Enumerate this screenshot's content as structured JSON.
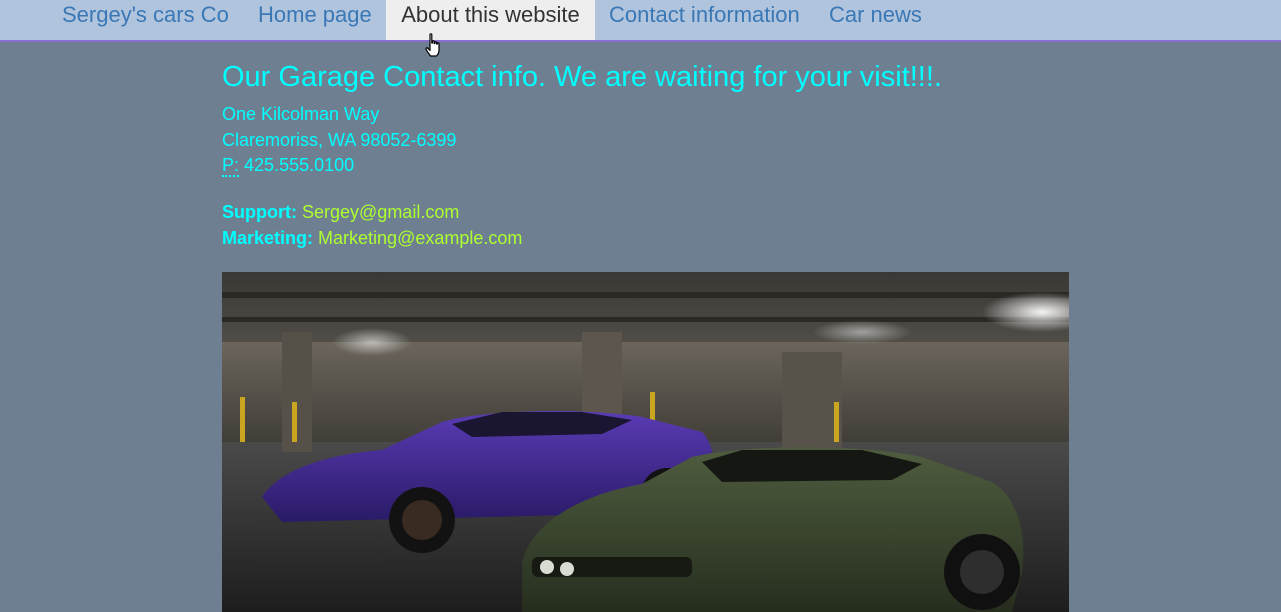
{
  "nav": {
    "brand": "Sergey's cars Co",
    "items": [
      {
        "label": "Home page"
      },
      {
        "label": "About this website"
      },
      {
        "label": "Contact information"
      },
      {
        "label": "Car news"
      }
    ],
    "active_index": 1
  },
  "main": {
    "title": "Our Garage Contact info. We are waiting for your visit!!!.",
    "address": {
      "street": "One Kilcolman Way",
      "city_line": "Claremoriss, WA 98052-6399",
      "phone_abbr": "P:",
      "phone": "425.555.0100"
    },
    "contacts": [
      {
        "label": "Support:",
        "email": "Sergey@gmail.com"
      },
      {
        "label": "Marketing:",
        "email": "Marketing@example.com"
      }
    ]
  },
  "photo": {
    "subject": "two muscle cars (purple and dark green) in a parking garage"
  },
  "colors": {
    "page_background": "#6e7f91",
    "navbar_background": "#b0c4de",
    "nav_link": "#3a78b5",
    "heading_text": "#00ffff",
    "email_link": "#adff2f"
  }
}
